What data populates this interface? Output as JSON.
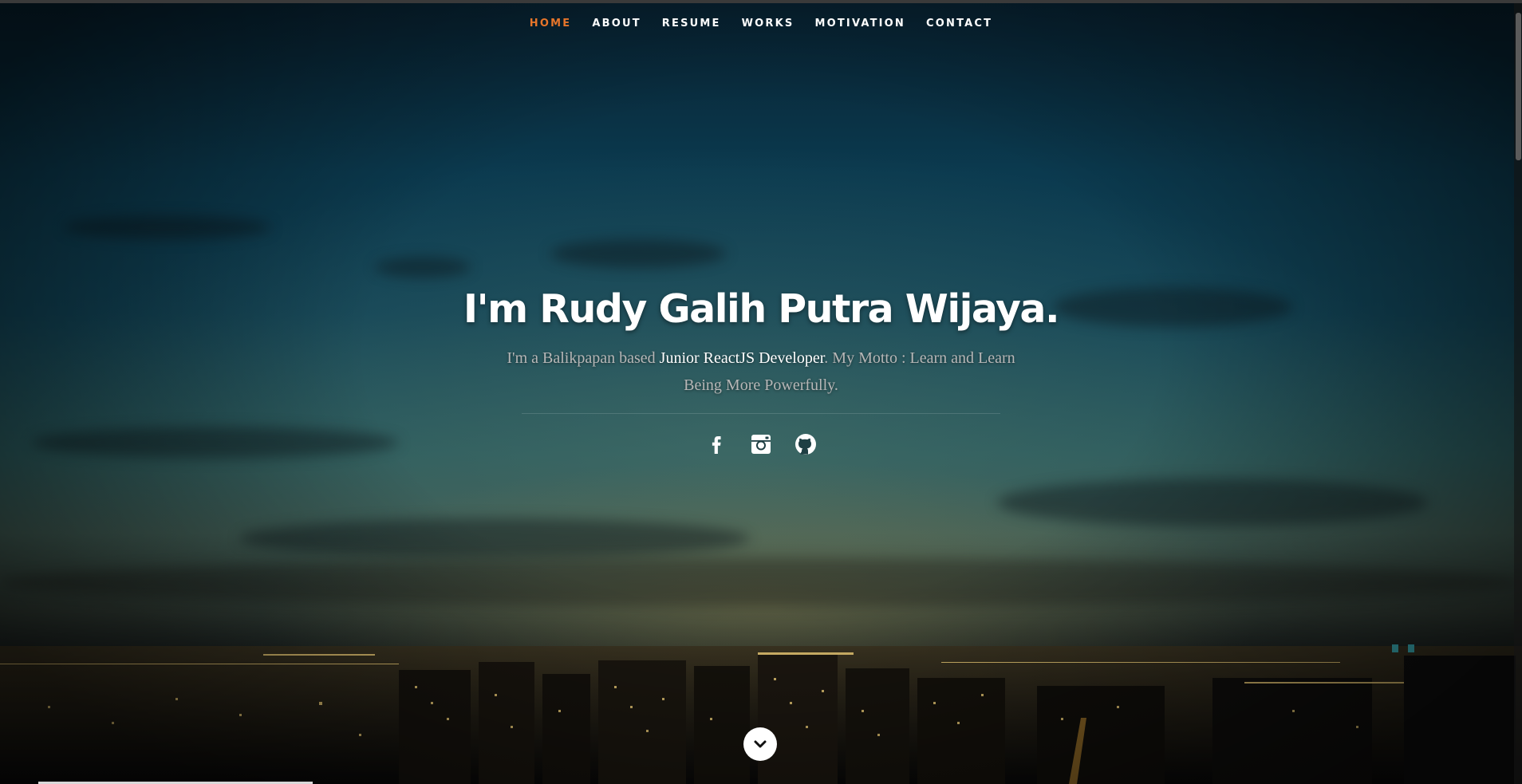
{
  "nav": {
    "items": [
      {
        "label": "HOME",
        "current": true
      },
      {
        "label": "ABOUT",
        "current": false
      },
      {
        "label": "RESUME",
        "current": false
      },
      {
        "label": "WORKS",
        "current": false
      },
      {
        "label": "MOTIVATION",
        "current": false
      },
      {
        "label": "CONTACT",
        "current": false
      }
    ],
    "active_color": "#e6752a"
  },
  "banner": {
    "heading": "I'm Rudy Galih Putra Wijaya.",
    "intro_before": "I'm a Balikpapan based ",
    "intro_role": "Junior ReactJS Developer",
    "intro_after": ". My Motto : Learn and Learn Being More Powerfully."
  },
  "social": {
    "icons": [
      "facebook-icon",
      "instagram-icon",
      "github-icon"
    ]
  },
  "scroll_down": {
    "icon": "chevron-down-icon"
  }
}
